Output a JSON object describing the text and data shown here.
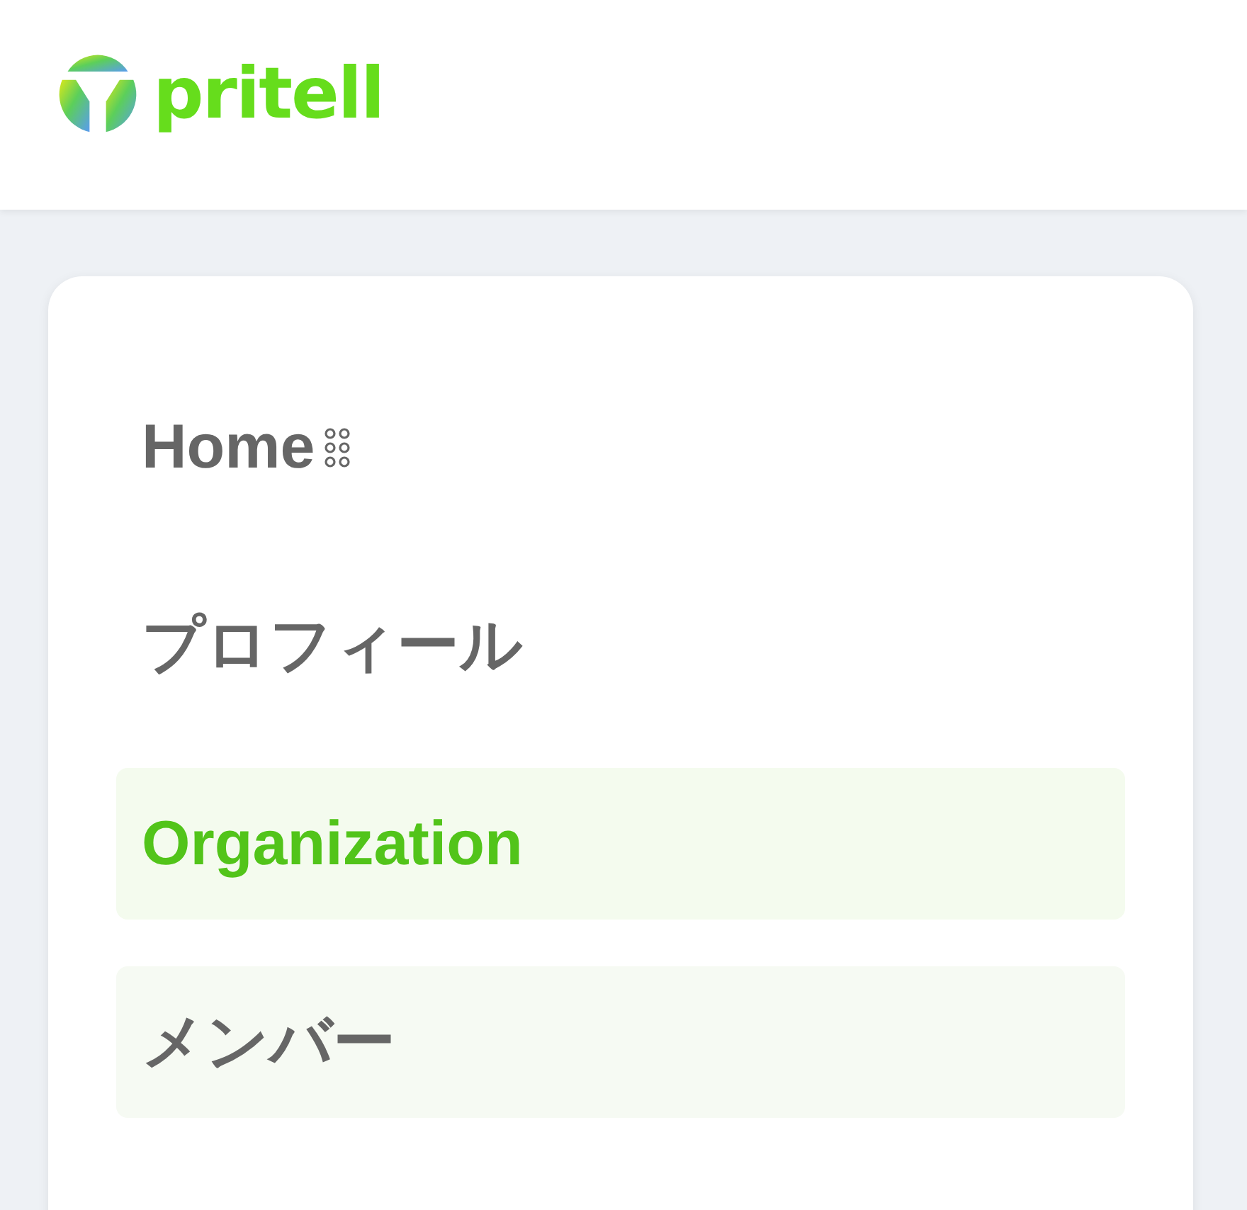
{
  "header": {
    "logo_text": "pritell"
  },
  "nav": {
    "items": [
      {
        "label": "Home",
        "selected": false,
        "hovered": false,
        "kind": "home"
      },
      {
        "label": "プロフィール",
        "selected": false,
        "hovered": false,
        "kind": "link"
      },
      {
        "label": "Organization",
        "selected": true,
        "hovered": false,
        "kind": "link"
      },
      {
        "label": "メンバー",
        "selected": false,
        "hovered": true,
        "kind": "link"
      }
    ]
  }
}
